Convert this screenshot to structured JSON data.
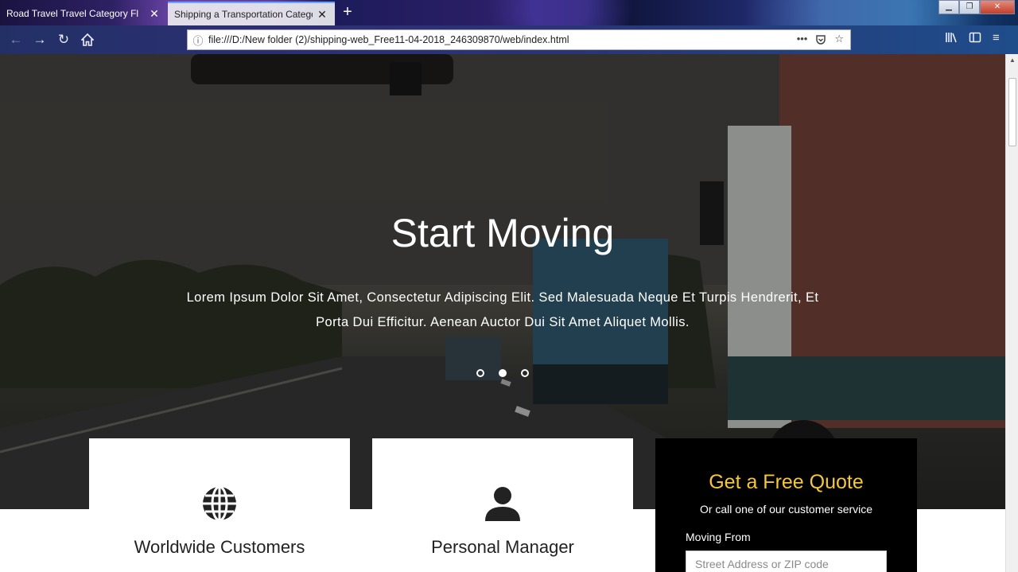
{
  "browser": {
    "tabs": [
      {
        "label": "Road Travel Travel Category Fl"
      },
      {
        "label": "Shipping a Transportation Category"
      }
    ],
    "new_tab": "+",
    "url": "file:///D:/New folder (2)/shipping-web_Free11-04-2018_246309870/web/index.html"
  },
  "hero": {
    "title": "Start Moving",
    "text": "Lorem Ipsum Dolor Sit Amet, Consectetur Adipiscing Elit. Sed Malesuada Neque Et Turpis Hendrerit, Et Porta Dui Efficitur. Aenean Auctor Dui Sit Amet Aliquet Mollis.",
    "slides": 3,
    "active_slide": 2
  },
  "features": [
    {
      "title": "Worldwide Customers",
      "icon": "globe-icon"
    },
    {
      "title": "Personal Manager",
      "icon": "user-icon"
    }
  ],
  "quote": {
    "title": "Get a Free Quote",
    "subtitle": "Or call one of our customer service",
    "field_label": "Moving From",
    "field_placeholder": "Street Address or ZIP code"
  },
  "colors": {
    "quote_accent": "#f5c63b",
    "quote_background": "#000000"
  }
}
